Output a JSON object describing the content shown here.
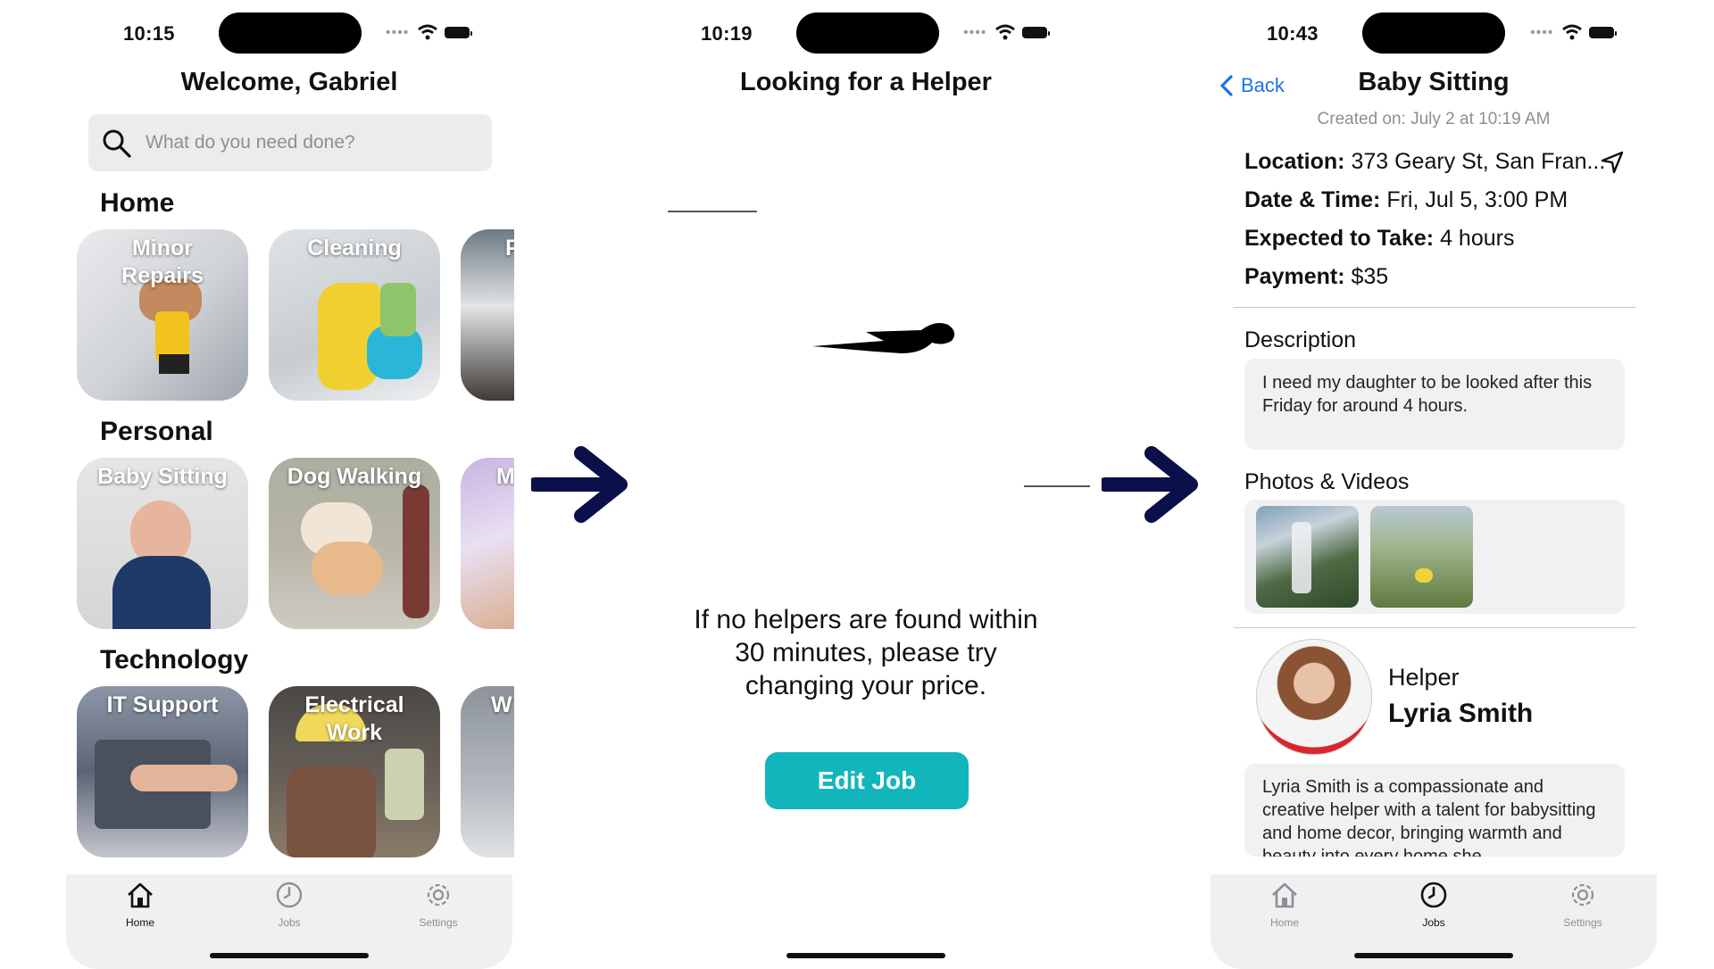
{
  "screens": {
    "home": {
      "status_time": "10:15",
      "title": "Welcome, Gabriel",
      "search": {
        "placeholder": "What do you need done?"
      },
      "sections": [
        {
          "title": "Home",
          "tiles": [
            "Minor Repairs",
            "Cleaning",
            "P"
          ]
        },
        {
          "title": "Personal",
          "tiles": [
            "Baby Sitting",
            "Dog Walking",
            "M"
          ]
        },
        {
          "title": "Technology",
          "tiles": [
            "IT Support",
            "Electrical Work",
            "W"
          ]
        }
      ],
      "tabbar": {
        "items": [
          "Home",
          "Jobs",
          "Settings"
        ],
        "active": "Home"
      }
    },
    "searching": {
      "status_time": "10:19",
      "title": "Looking for a Helper",
      "message": "If no helpers are found within 30 minutes, please try changing your price.",
      "message_lines": [
        "If no helpers are found within",
        "30 minutes, please try",
        "changing your price."
      ],
      "edit_button": "Edit Job"
    },
    "job_detail": {
      "status_time": "10:43",
      "back_label": "Back",
      "title": "Baby Sitting",
      "created": "Created on: July 2 at 10:19 AM",
      "details": [
        {
          "label": "Location:",
          "value": "373 Geary St, San Fran..."
        },
        {
          "label": "Date & Time:",
          "value": "Fri, Jul 5, 3:00 PM"
        },
        {
          "label": "Expected to Take:",
          "value": "4 hours"
        },
        {
          "label": "Payment:",
          "value": "$35"
        }
      ],
      "description_title": "Description",
      "description": "I need my daughter to be looked after this Friday for around 4 hours.",
      "photos_title": "Photos & Videos",
      "helper_role": "Helper",
      "helper_name": "Lyria Smith",
      "helper_bio": "Lyria Smith is a compassionate and creative helper with a talent for babysitting and home decor, bringing warmth and beauty into every home she",
      "tabbar": {
        "items": [
          "Home",
          "Jobs",
          "Settings"
        ],
        "active": "Jobs"
      }
    }
  },
  "colors": {
    "accent_teal": "#13b5bd",
    "link_blue": "#1a73e8",
    "arrow_navy": "#0b0f4a",
    "tabbar_bg": "#f0f0f2"
  }
}
